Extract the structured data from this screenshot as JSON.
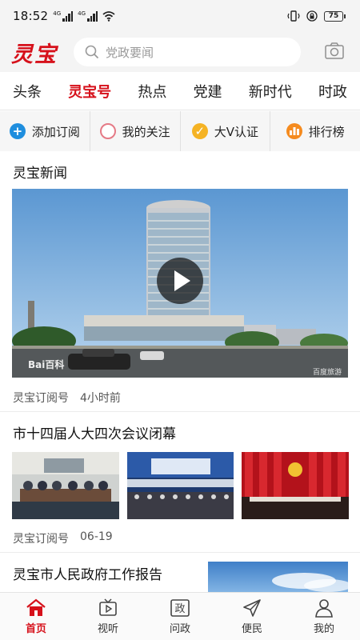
{
  "status_bar": {
    "time": "18:52",
    "network_1": "4G",
    "network_2": "4G",
    "battery": "75",
    "icons": [
      "signal-icon",
      "signal-icon",
      "wifi-icon",
      "vibrate-icon",
      "lock-icon",
      "battery-icon"
    ]
  },
  "header": {
    "logo": "灵宝",
    "search_placeholder": "党政要闻",
    "camera_icon": "camera-icon"
  },
  "tabs": [
    {
      "label": "头条",
      "active": false
    },
    {
      "label": "灵宝号",
      "active": true
    },
    {
      "label": "热点",
      "active": false
    },
    {
      "label": "党建",
      "active": false
    },
    {
      "label": "新时代",
      "active": false
    },
    {
      "label": "时政",
      "active": false
    }
  ],
  "quick_actions": [
    {
      "label": "添加订阅",
      "icon": "plus-icon",
      "color": "#1f8ede"
    },
    {
      "label": "我的关注",
      "icon": "circle-icon",
      "color": "#e57a86"
    },
    {
      "label": "大V认证",
      "icon": "check-icon",
      "color": "#f5b324"
    },
    {
      "label": "排行榜",
      "icon": "rank-icon",
      "color": "#f58b1f"
    }
  ],
  "feed": {
    "section_title": "灵宝新闻",
    "hero": {
      "watermark_left": "Bai百科",
      "watermark_right": "百度旅游"
    },
    "items": [
      {
        "source": "灵宝订阅号",
        "time": "4小时前"
      },
      {
        "title": "市十四届人大四次会议闭幕",
        "source": "灵宝订阅号",
        "time": "06-19"
      },
      {
        "title": "灵宝市人民政府工作报告"
      }
    ]
  },
  "bottom_nav": [
    {
      "label": "首页",
      "icon": "home-icon",
      "active": true
    },
    {
      "label": "视听",
      "icon": "tv-icon",
      "active": false
    },
    {
      "label": "问政",
      "icon": "zheng-icon",
      "icon_text": "政",
      "active": false
    },
    {
      "label": "便民",
      "icon": "send-icon",
      "active": false
    },
    {
      "label": "我的",
      "icon": "user-icon",
      "active": false
    }
  ],
  "colors": {
    "brand_red": "#d6111b",
    "header_bg": "#f4f4f4",
    "muted_text": "#555555"
  }
}
